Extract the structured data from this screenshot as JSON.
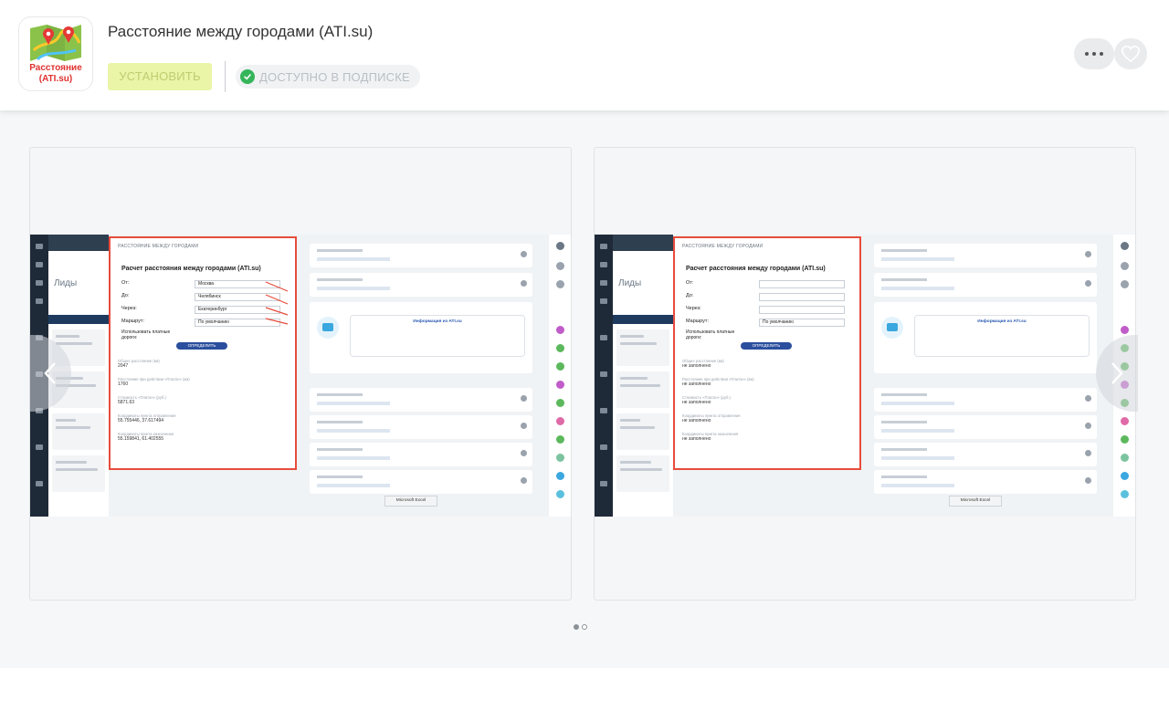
{
  "app": {
    "title": "Расстояние между городами (ATI.su)",
    "icon_caption_line1": "Расстояние",
    "icon_caption_line2": "(ATI.su)",
    "install_label": "УСТАНОВИТЬ",
    "subscription_label": "ДОСТУПНО В ПОДПИСКЕ"
  },
  "screenshot": {
    "crm_section": "Лиды",
    "panel_heading": "РАССТОЯНИЕ МЕЖДУ ГОРОДАМИ",
    "panel_title": "Расчет расстояния между городами (ATI.su)",
    "fields": [
      {
        "label": "От:",
        "value": "Москва"
      },
      {
        "label": "До:",
        "value": "Челябинск"
      },
      {
        "label": "Через:",
        "value": "Екатеринбург"
      },
      {
        "label": "Маршрут:",
        "value": "По умолчанию"
      }
    ],
    "toll_label": "Использовать платные дороги:",
    "calc_button": "ОПРЕДЕЛИТЬ",
    "results": [
      {
        "label": "Общее расстояние (км)",
        "value": "2047"
      },
      {
        "label": "Расстояние при действии «Платон» (км)",
        "value": "1760"
      },
      {
        "label": "Стоимость «Платон» (руб.)",
        "value": "5871.63"
      },
      {
        "label": "Координаты пункта отправления",
        "value": "55.755446, 37.617494"
      },
      {
        "label": "Координаты пункта назначения",
        "value": "55.159841, 61.402555"
      }
    ],
    "empty_value": "не заполнено",
    "info_title": "Информация из ATI.su",
    "excel_label": "Microsoft Excel"
  },
  "colors": {
    "install_bg": "#eaf5a7",
    "check_green": "#35b55a",
    "panel_border": "#e74c3c",
    "crm_dark": "#1f2a38",
    "button_blue": "#2b4f9e"
  },
  "gallery": {
    "slide_count": 2,
    "active_slide": 1
  }
}
